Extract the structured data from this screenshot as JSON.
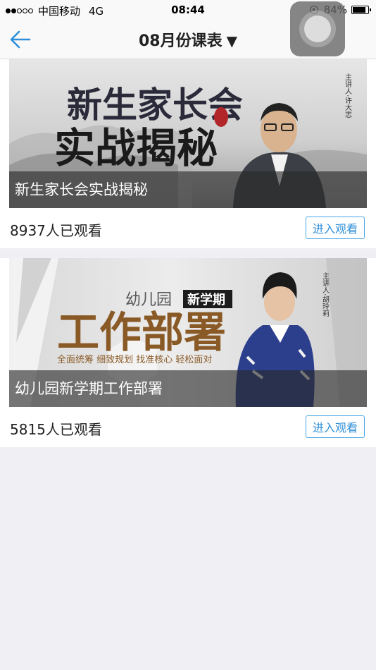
{
  "status_bar": {
    "carrier": "中国移动",
    "network": "4G",
    "time": "08:44",
    "battery": "84%",
    "battery_level": 0.84
  },
  "nav": {
    "back_icon": "arrow-left-icon",
    "title": "08月份课表",
    "caret": "▼"
  },
  "courses": [
    {
      "banner_title_line1": "新生家长会",
      "banner_title_line2": "实战揭秘",
      "speaker_tag": "主讲人·许大志",
      "caption": "新生家长会实战揭秘",
      "views": "8937人已观看",
      "button_label": "进入观看"
    },
    {
      "banner_small": "幼儿园",
      "banner_badge": "新学期",
      "banner_title": "工作部署",
      "banner_subtitle": "全面统筹 细致规划 找准核心 轻松面对",
      "speaker_tag": "主讲人·胡玲莉",
      "caption": "幼儿园新学期工作部署",
      "views": "5815人已观看",
      "button_label": "进入观看"
    }
  ],
  "colors": {
    "accent": "#2e8fd8",
    "background": "#efeff4"
  }
}
